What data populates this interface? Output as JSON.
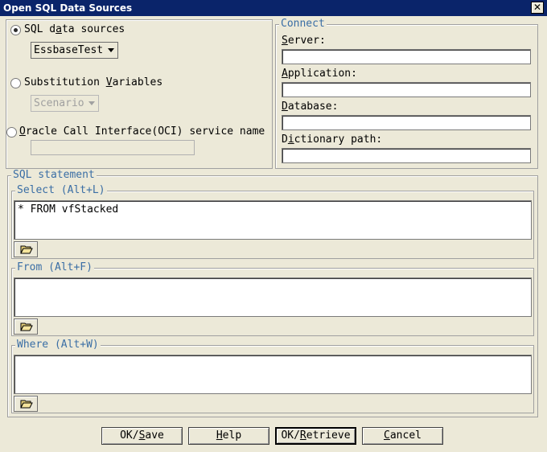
{
  "window": {
    "title": "Open SQL Data Sources",
    "close_glyph": "✕"
  },
  "source": {
    "sql_label_pre": "SQL d",
    "sql_label_ul": "a",
    "sql_label_post": "ta sources",
    "sql_selected": "EssbaseTest",
    "subst_label_pre": "Substitution ",
    "subst_label_ul": "V",
    "subst_label_post": "ariables",
    "subst_selected": "Scenario",
    "oci_label_ul": "O",
    "oci_label_post": "racle Call Interface(OCI) service name",
    "oci_value": "",
    "selected_option": "sql_data_sources"
  },
  "connect": {
    "legend": "Connect",
    "server_ul": "S",
    "server_post": "erver:",
    "server_value": "",
    "application_ul": "A",
    "application_post": "pplication:",
    "application_value": "",
    "database_ul": "D",
    "database_post": "atabase:",
    "database_value": "",
    "dict_pre": "D",
    "dict_ul": "i",
    "dict_post": "ctionary path:",
    "dict_value": ""
  },
  "sql": {
    "legend": "SQL statement",
    "select_legend": "Select (Alt+L)",
    "select_value": "* FROM vfStacked",
    "from_legend": "From (Alt+F)",
    "from_value": "",
    "where_legend": "Where (Alt+W)",
    "where_value": ""
  },
  "buttons": {
    "ok_save_pre": "OK/",
    "ok_save_ul": "S",
    "ok_save_post": "ave",
    "help_ul": "H",
    "help_post": "elp",
    "ok_retrieve_pre": "OK/",
    "ok_retrieve_ul": "R",
    "ok_retrieve_post": "etrieve",
    "cancel_ul": "C",
    "cancel_post": "ancel"
  },
  "icons": {
    "folder": "folder-open-icon",
    "close": "close-icon",
    "dropdown": "chevron-down-icon"
  }
}
